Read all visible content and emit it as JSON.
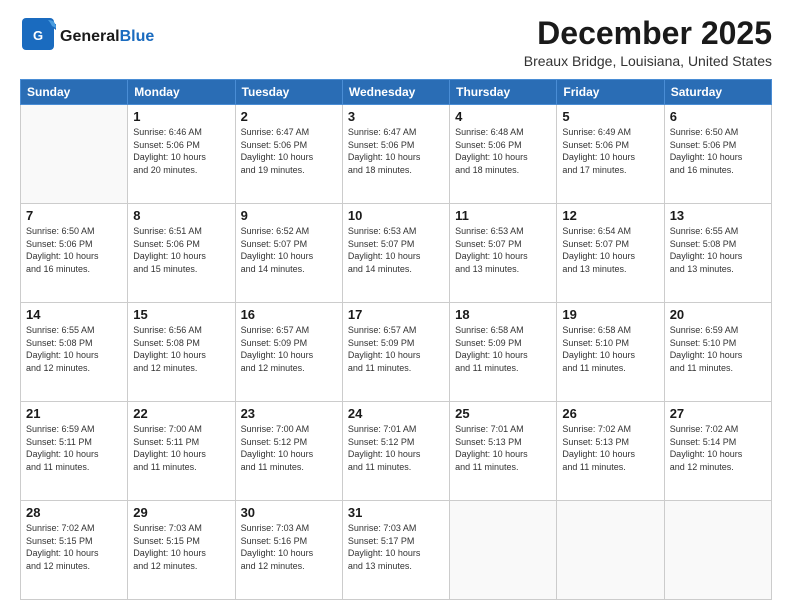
{
  "header": {
    "logo_general": "General",
    "logo_blue": "Blue",
    "month_title": "December 2025",
    "location": "Breaux Bridge, Louisiana, United States"
  },
  "calendar": {
    "days_of_week": [
      "Sunday",
      "Monday",
      "Tuesday",
      "Wednesday",
      "Thursday",
      "Friday",
      "Saturday"
    ],
    "weeks": [
      [
        {
          "day": "",
          "info": ""
        },
        {
          "day": "1",
          "info": "Sunrise: 6:46 AM\nSunset: 5:06 PM\nDaylight: 10 hours\nand 20 minutes."
        },
        {
          "day": "2",
          "info": "Sunrise: 6:47 AM\nSunset: 5:06 PM\nDaylight: 10 hours\nand 19 minutes."
        },
        {
          "day": "3",
          "info": "Sunrise: 6:47 AM\nSunset: 5:06 PM\nDaylight: 10 hours\nand 18 minutes."
        },
        {
          "day": "4",
          "info": "Sunrise: 6:48 AM\nSunset: 5:06 PM\nDaylight: 10 hours\nand 18 minutes."
        },
        {
          "day": "5",
          "info": "Sunrise: 6:49 AM\nSunset: 5:06 PM\nDaylight: 10 hours\nand 17 minutes."
        },
        {
          "day": "6",
          "info": "Sunrise: 6:50 AM\nSunset: 5:06 PM\nDaylight: 10 hours\nand 16 minutes."
        }
      ],
      [
        {
          "day": "7",
          "info": "Sunrise: 6:50 AM\nSunset: 5:06 PM\nDaylight: 10 hours\nand 16 minutes."
        },
        {
          "day": "8",
          "info": "Sunrise: 6:51 AM\nSunset: 5:06 PM\nDaylight: 10 hours\nand 15 minutes."
        },
        {
          "day": "9",
          "info": "Sunrise: 6:52 AM\nSunset: 5:07 PM\nDaylight: 10 hours\nand 14 minutes."
        },
        {
          "day": "10",
          "info": "Sunrise: 6:53 AM\nSunset: 5:07 PM\nDaylight: 10 hours\nand 14 minutes."
        },
        {
          "day": "11",
          "info": "Sunrise: 6:53 AM\nSunset: 5:07 PM\nDaylight: 10 hours\nand 13 minutes."
        },
        {
          "day": "12",
          "info": "Sunrise: 6:54 AM\nSunset: 5:07 PM\nDaylight: 10 hours\nand 13 minutes."
        },
        {
          "day": "13",
          "info": "Sunrise: 6:55 AM\nSunset: 5:08 PM\nDaylight: 10 hours\nand 13 minutes."
        }
      ],
      [
        {
          "day": "14",
          "info": "Sunrise: 6:55 AM\nSunset: 5:08 PM\nDaylight: 10 hours\nand 12 minutes."
        },
        {
          "day": "15",
          "info": "Sunrise: 6:56 AM\nSunset: 5:08 PM\nDaylight: 10 hours\nand 12 minutes."
        },
        {
          "day": "16",
          "info": "Sunrise: 6:57 AM\nSunset: 5:09 PM\nDaylight: 10 hours\nand 12 minutes."
        },
        {
          "day": "17",
          "info": "Sunrise: 6:57 AM\nSunset: 5:09 PM\nDaylight: 10 hours\nand 11 minutes."
        },
        {
          "day": "18",
          "info": "Sunrise: 6:58 AM\nSunset: 5:09 PM\nDaylight: 10 hours\nand 11 minutes."
        },
        {
          "day": "19",
          "info": "Sunrise: 6:58 AM\nSunset: 5:10 PM\nDaylight: 10 hours\nand 11 minutes."
        },
        {
          "day": "20",
          "info": "Sunrise: 6:59 AM\nSunset: 5:10 PM\nDaylight: 10 hours\nand 11 minutes."
        }
      ],
      [
        {
          "day": "21",
          "info": "Sunrise: 6:59 AM\nSunset: 5:11 PM\nDaylight: 10 hours\nand 11 minutes."
        },
        {
          "day": "22",
          "info": "Sunrise: 7:00 AM\nSunset: 5:11 PM\nDaylight: 10 hours\nand 11 minutes."
        },
        {
          "day": "23",
          "info": "Sunrise: 7:00 AM\nSunset: 5:12 PM\nDaylight: 10 hours\nand 11 minutes."
        },
        {
          "day": "24",
          "info": "Sunrise: 7:01 AM\nSunset: 5:12 PM\nDaylight: 10 hours\nand 11 minutes."
        },
        {
          "day": "25",
          "info": "Sunrise: 7:01 AM\nSunset: 5:13 PM\nDaylight: 10 hours\nand 11 minutes."
        },
        {
          "day": "26",
          "info": "Sunrise: 7:02 AM\nSunset: 5:13 PM\nDaylight: 10 hours\nand 11 minutes."
        },
        {
          "day": "27",
          "info": "Sunrise: 7:02 AM\nSunset: 5:14 PM\nDaylight: 10 hours\nand 12 minutes."
        }
      ],
      [
        {
          "day": "28",
          "info": "Sunrise: 7:02 AM\nSunset: 5:15 PM\nDaylight: 10 hours\nand 12 minutes."
        },
        {
          "day": "29",
          "info": "Sunrise: 7:03 AM\nSunset: 5:15 PM\nDaylight: 10 hours\nand 12 minutes."
        },
        {
          "day": "30",
          "info": "Sunrise: 7:03 AM\nSunset: 5:16 PM\nDaylight: 10 hours\nand 12 minutes."
        },
        {
          "day": "31",
          "info": "Sunrise: 7:03 AM\nSunset: 5:17 PM\nDaylight: 10 hours\nand 13 minutes."
        },
        {
          "day": "",
          "info": ""
        },
        {
          "day": "",
          "info": ""
        },
        {
          "day": "",
          "info": ""
        }
      ]
    ]
  }
}
